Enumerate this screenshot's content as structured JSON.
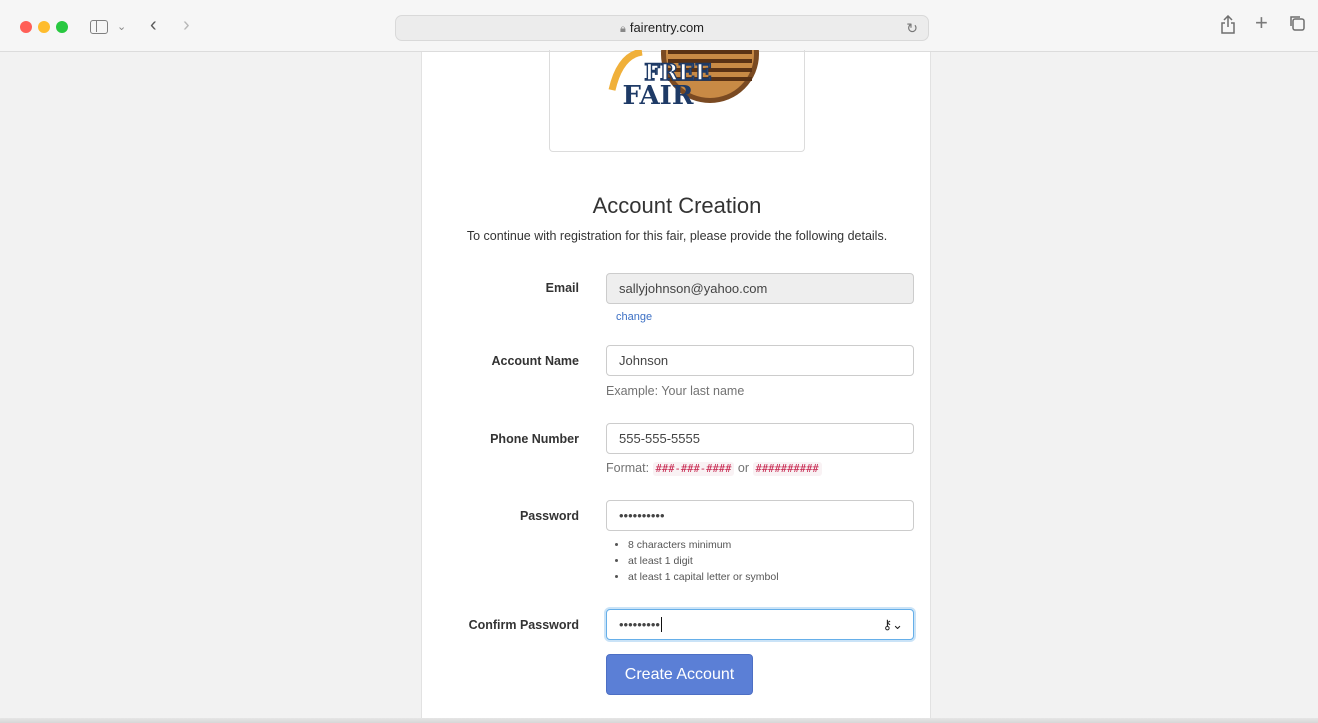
{
  "browser": {
    "url": "fairentry.com"
  },
  "logo": {
    "line1": "FREE",
    "line2": "FAIR"
  },
  "page": {
    "title": "Account Creation",
    "subtitle": "To continue with registration for this fair, please provide the following details."
  },
  "form": {
    "email": {
      "label": "Email",
      "value": "sallyjohnson@yahoo.com",
      "change_link": "change"
    },
    "account_name": {
      "label": "Account Name",
      "value": "Johnson",
      "help": "Example: Your last name"
    },
    "phone": {
      "label": "Phone Number",
      "value": "555-555-5555",
      "help_prefix": "Format:",
      "format1": "###-###-####",
      "help_or": "or",
      "format2": "##########"
    },
    "password": {
      "label": "Password",
      "value": "••••••••••",
      "rules": [
        "8 characters minimum",
        "at least 1 digit",
        "at least 1 capital letter or symbol"
      ]
    },
    "confirm_password": {
      "label": "Confirm Password",
      "value": "•••••••••"
    },
    "submit_label": "Create Account"
  },
  "colors": {
    "button": "#5b7fd6",
    "link": "#3b6fc4",
    "code_text": "#c7254e",
    "focus_border": "#66afe9"
  }
}
